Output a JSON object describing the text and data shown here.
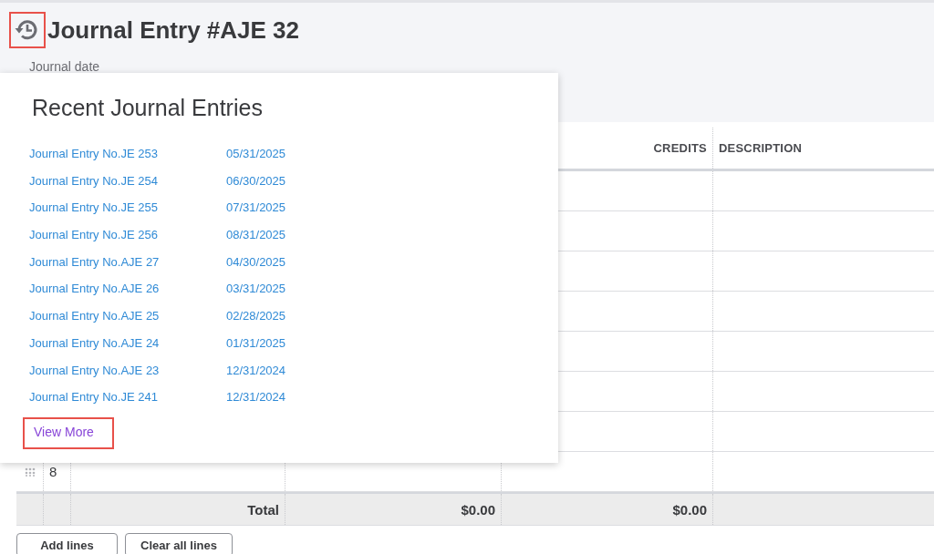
{
  "header": {
    "title": "Journal Entry #AJE 32",
    "history_icon_highlighted": true,
    "date_label": "Journal date"
  },
  "table": {
    "columns": [
      {
        "label": "CREDITS"
      },
      {
        "label": "DESCRIPTION"
      }
    ],
    "rows": [
      {
        "number": "8"
      }
    ],
    "total": {
      "label": "Total",
      "debits": "$0.00",
      "credits": "$0.00"
    }
  },
  "buttons": [
    "Add lines",
    "Clear all lines"
  ],
  "popover": {
    "title": "Recent Journal Entries",
    "entries": [
      {
        "name": "Journal Entry No.JE 253",
        "date": "05/31/2025"
      },
      {
        "name": "Journal Entry No.JE 254",
        "date": "06/30/2025"
      },
      {
        "name": "Journal Entry No.JE 255",
        "date": "07/31/2025"
      },
      {
        "name": "Journal Entry No.JE 256",
        "date": "08/31/2025"
      },
      {
        "name": "Journal Entry No.AJE 27",
        "date": "04/30/2025"
      },
      {
        "name": "Journal Entry No.AJE 26",
        "date": "03/31/2025"
      },
      {
        "name": "Journal Entry No.AJE 25",
        "date": "02/28/2025"
      },
      {
        "name": "Journal Entry No.AJE 24",
        "date": "01/31/2025"
      },
      {
        "name": "Journal Entry No.AJE 23",
        "date": "12/31/2024"
      },
      {
        "name": "Journal Entry No.JE 241",
        "date": "12/31/2024"
      }
    ],
    "view_more": {
      "label": "View More",
      "highlighted": true
    }
  }
}
